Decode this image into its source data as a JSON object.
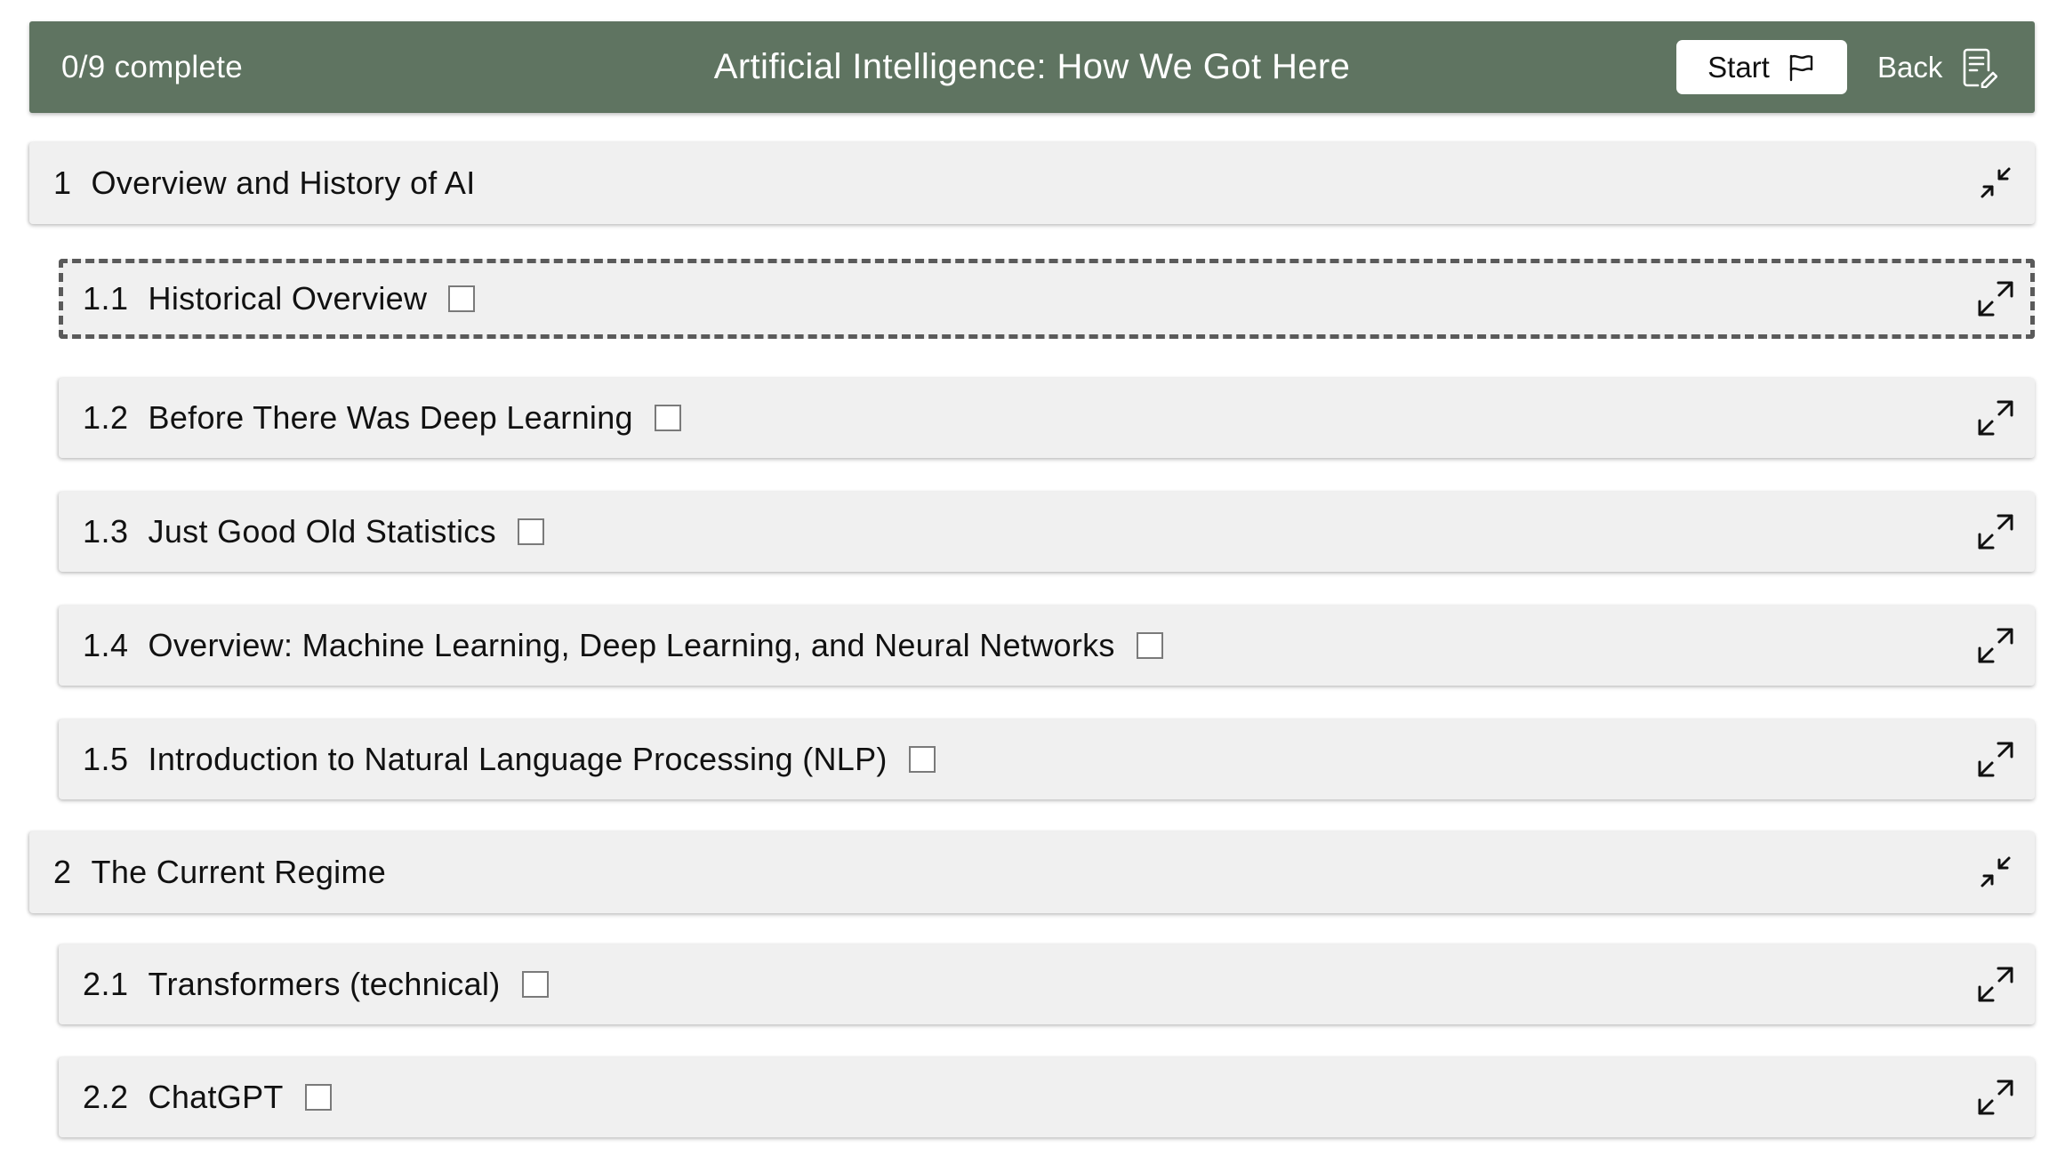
{
  "header": {
    "progress": "0/9 complete",
    "title": "Artificial Intelligence: How We Got Here",
    "start_label": "Start",
    "back_label": "Back",
    "bg_color": "#5f7461"
  },
  "outline": [
    {
      "type": "section",
      "num": "1",
      "label": "Overview and History of AI",
      "state": "collapse"
    },
    {
      "type": "lesson",
      "num": "1.1",
      "label": "Historical Overview",
      "checked": false,
      "selected": true
    },
    {
      "type": "lesson",
      "num": "1.2",
      "label": "Before There Was Deep Learning",
      "checked": false
    },
    {
      "type": "lesson",
      "num": "1.3",
      "label": "Just Good Old Statistics",
      "checked": false
    },
    {
      "type": "lesson",
      "num": "1.4",
      "label": "Overview: Machine Learning, Deep Learning, and Neural Networks",
      "checked": false
    },
    {
      "type": "lesson",
      "num": "1.5",
      "label": "Introduction to Natural Language Processing (NLP)",
      "checked": false
    },
    {
      "type": "section",
      "num": "2",
      "label": "The Current Regime",
      "state": "collapse"
    },
    {
      "type": "lesson",
      "num": "2.1",
      "label": "Transformers (technical)",
      "checked": false
    },
    {
      "type": "lesson",
      "num": "2.2",
      "label": "ChatGPT",
      "checked": false
    }
  ]
}
